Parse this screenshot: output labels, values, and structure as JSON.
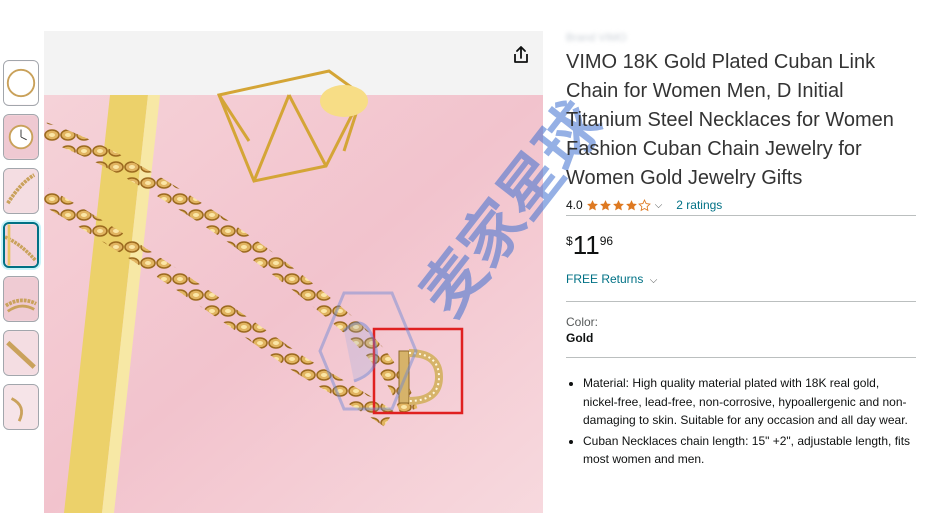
{
  "product": {
    "brand": "Brand VIMO",
    "title": "VIMO 18K Gold Plated Cuban Link Chain for Women Men, D Initial Titanium Steel Necklaces for Women Fashion Cuban Chain Jewelry for Women Gold Jewelry Gifts",
    "rating_value": "4.0",
    "rating_stars": 4,
    "ratings_count": "2 ratings",
    "price": {
      "symbol": "$",
      "whole": "11",
      "fraction": "96"
    },
    "returns": "FREE Returns",
    "color_label": "Color:",
    "color_value": "Gold",
    "bullets": [
      "Material: High quality material plated with 18K real gold, nickel-free, lead-free, non-corrosive, hypoallergenic and non-damaging to skin. Suitable for any occasion and all day wear.",
      "Cuban Necklaces chain length: 15\" +2\", adjustable length, fits most women and men."
    ]
  },
  "gallery": {
    "thumbnails": [
      "hoop-thumb",
      "clock-thumb",
      "chain-thumb",
      "necklace-thumb",
      "bracelet-thumb",
      "tube-thumb",
      "pendant-thumb"
    ],
    "selected_index": 3
  },
  "watermark": {
    "text": "麦家星球"
  },
  "colors": {
    "link": "#007185",
    "star": "#de7921",
    "highlight_box": "#e02020"
  }
}
